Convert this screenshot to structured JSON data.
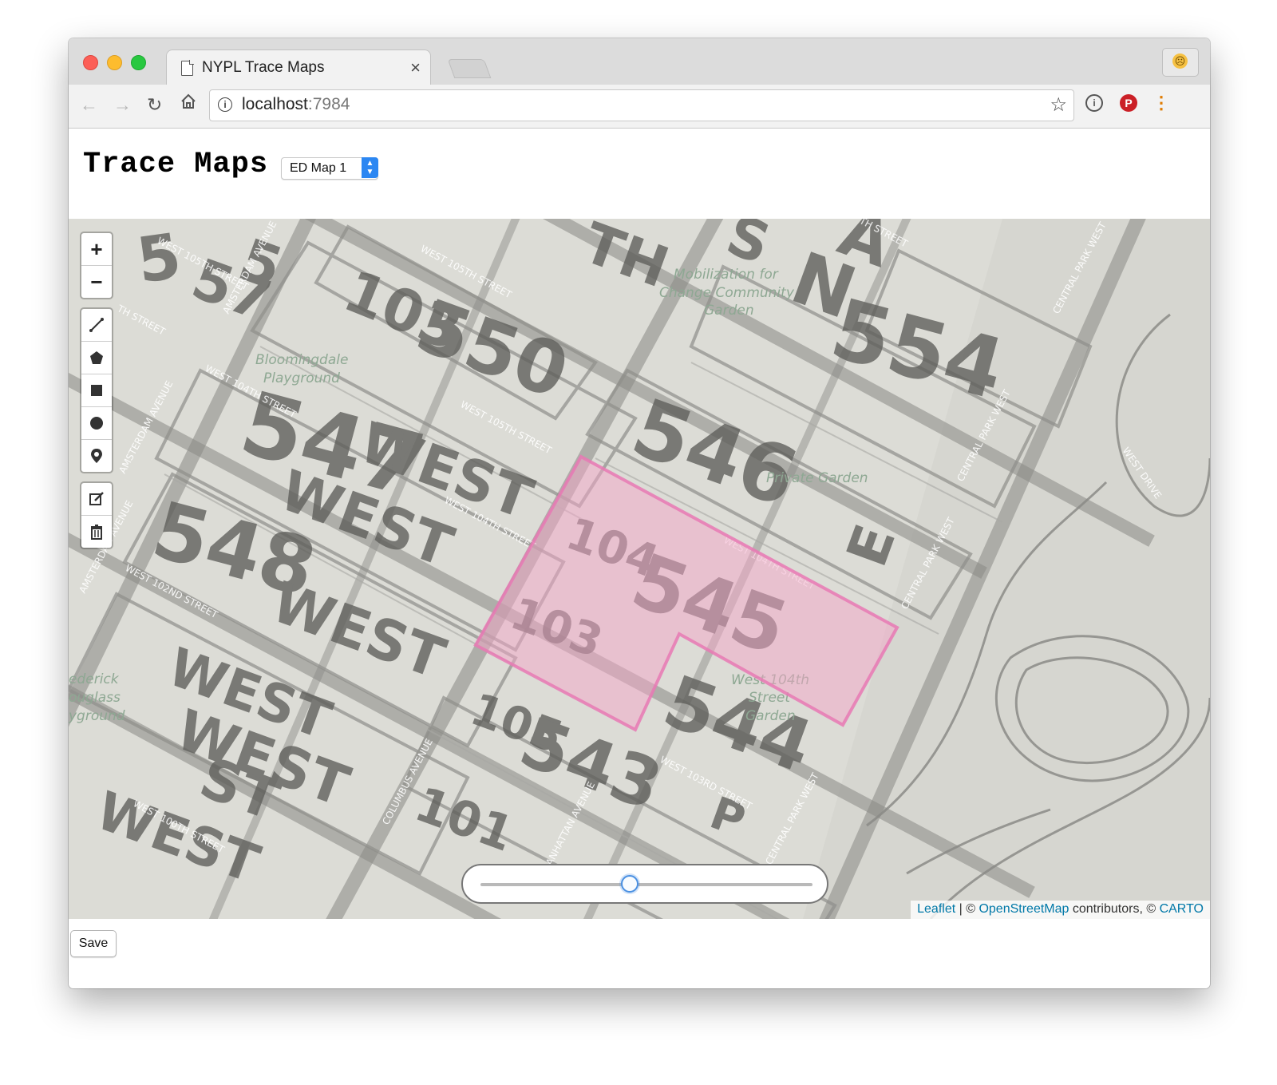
{
  "browser": {
    "tab_title": "NYPL Trace Maps",
    "tab_close": "×",
    "url_host": "localhost",
    "url_port": ":7984"
  },
  "page": {
    "title": "Trace Maps",
    "map_select": {
      "selected": "ED Map 1"
    }
  },
  "map": {
    "zoom_in": "+",
    "zoom_out": "−",
    "draw_tools": [
      "polyline-icon",
      "polygon-icon",
      "rectangle-icon",
      "circle-icon",
      "marker-icon"
    ],
    "edit_tools": [
      "edit-icon",
      "trash-icon"
    ],
    "opacity_slider": {
      "value": 0.45
    },
    "attribution": {
      "leaflet": "Leaflet",
      "sep": " | © ",
      "osm": "OpenStreetMap",
      "mid": " contributors, © ",
      "carto": "CARTO"
    },
    "basemap_labels": [
      "Mobilization for",
      "Change Community",
      "Garden",
      "Bloomingdale",
      "Playground",
      "Private Garden",
      "West 104th",
      "Street",
      "Garden",
      "ederick",
      "ouglass",
      "yground"
    ],
    "street_labels": [
      "WEST 105TH STREET",
      "WEST 104TH STREET",
      "WEST 105TH STREET",
      "WEST 104TH STREET",
      "WEST 102ND STREET",
      "WEST 100TH STREET",
      "WEST 103RD STREET",
      "WEST 105TH STREET",
      "WEST 104TH STREET",
      "AMSTERDAM AVENUE",
      "AMSTERDAM AVENUE",
      "AMSTERDAM AVENUE",
      "COLUMBUS AVENUE",
      "MANHATTAN AVENUE",
      "CENTRAL PARK WEST",
      "CENTRAL PARK WEST",
      "CENTRAL PARK WEST",
      "CENTRAL PARK WEST",
      "WEST DRIVE",
      "TH STREET",
      "TH STREET"
    ],
    "historic_numbers": [
      "5",
      "57",
      "103",
      "550",
      "554",
      "546",
      "547",
      "548",
      "545",
      "5",
      "104",
      "103",
      "105",
      "544",
      "543",
      "101",
      "WEST",
      "WEST",
      "WEST",
      "WEST",
      "WEST",
      "ST",
      "WEST",
      "E",
      "N",
      "A",
      "TH",
      "S",
      "P"
    ]
  },
  "save_label": "Save",
  "colors": {
    "trace_fill": "#f3a6c8",
    "trace_stroke": "#e879b4",
    "accent": "#2c87f2",
    "link": "#0078a8"
  }
}
